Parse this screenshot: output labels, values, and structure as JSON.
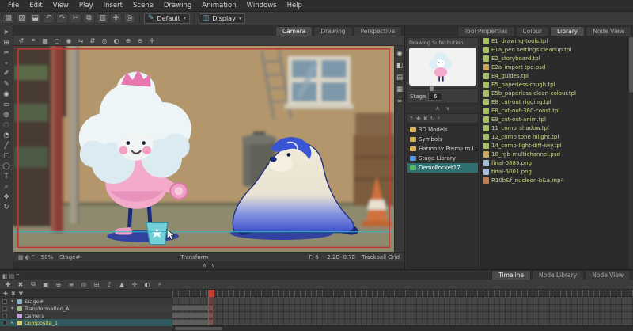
{
  "colors": {
    "accent_red": "#c63c32",
    "selection_teal": "#2f6f6f",
    "file_text_green": "#c9d48a",
    "layer_selected_yellow": "#e0d878",
    "camera_frame_red": "#bf3a34",
    "guide_cyan": "#35b8c4"
  },
  "menu_bar": {
    "items": [
      "File",
      "Edit",
      "View",
      "Play",
      "Insert",
      "Scene",
      "Drawing",
      "Animation",
      "Windows",
      "Help"
    ]
  },
  "top_toolbar": {
    "icons": [
      {
        "name": "new-scene-icon",
        "glyph": "▤"
      },
      {
        "name": "open-scene-icon",
        "glyph": "▧"
      },
      {
        "name": "save-icon",
        "glyph": "⬓"
      },
      {
        "name": "undo-icon",
        "glyph": "↶"
      },
      {
        "name": "redo-icon",
        "glyph": "↷"
      },
      {
        "name": "cut-icon",
        "glyph": "✂"
      },
      {
        "name": "copy-icon",
        "glyph": "⧉"
      },
      {
        "name": "paste-icon",
        "glyph": "▥"
      },
      {
        "name": "add-drawing-icon",
        "glyph": "✚"
      },
      {
        "name": "onion-skin-icon",
        "glyph": "◎"
      }
    ],
    "preset_dropdown_value": "Default",
    "brush_icon_glyph": "✎",
    "display_icon_glyph": "◫",
    "display_dropdown_value": "Display"
  },
  "tool_strip": {
    "icons": [
      {
        "name": "select-tool-icon",
        "glyph": "➤"
      },
      {
        "name": "transform-tool-icon",
        "glyph": "⊞"
      },
      {
        "name": "cutter-tool-icon",
        "glyph": "✂"
      },
      {
        "name": "contour-editor-icon",
        "glyph": "⌖"
      },
      {
        "name": "pencil-editor-icon",
        "glyph": "✐"
      },
      {
        "name": "brush-tool-icon",
        "glyph": "✎"
      },
      {
        "name": "stamp-tool-icon",
        "glyph": "◉"
      },
      {
        "name": "eraser-tool-icon",
        "glyph": "▭"
      },
      {
        "name": "paint-tool-icon",
        "glyph": "◍"
      },
      {
        "name": "ink-tool-icon",
        "glyph": "◌"
      },
      {
        "name": "dropper-tool-icon",
        "glyph": "◔"
      },
      {
        "name": "line-tool-icon",
        "glyph": "╱"
      },
      {
        "name": "rectangle-tool-icon",
        "glyph": "▢"
      },
      {
        "name": "ellipse-tool-icon",
        "glyph": "◯"
      },
      {
        "name": "text-tool-icon",
        "glyph": "T"
      },
      {
        "name": "zoom-tool-icon",
        "glyph": "⌕"
      },
      {
        "name": "hand-tool-icon",
        "glyph": "✥"
      },
      {
        "name": "rotate-view-icon",
        "glyph": "↻"
      }
    ]
  },
  "camera_panel": {
    "tabs": [
      {
        "label": "Camera",
        "active": true
      },
      {
        "label": "Drawing"
      },
      {
        "label": "Perspective"
      }
    ],
    "toolbar_icons": [
      {
        "name": "reset-view-icon",
        "glyph": "↺"
      },
      {
        "name": "grid-icon",
        "glyph": "⌗"
      },
      {
        "name": "safe-area-icon",
        "glyph": "▦"
      },
      {
        "name": "outline-mode-icon",
        "glyph": "◻"
      },
      {
        "name": "render-mode-icon",
        "glyph": "◉"
      },
      {
        "name": "flip-horizontal-icon",
        "glyph": "⇋"
      },
      {
        "name": "flip-vertical-icon",
        "glyph": "⇵"
      },
      {
        "name": "onion-skin-icon",
        "glyph": "◎"
      },
      {
        "name": "light-table-icon",
        "glyph": "◐"
      },
      {
        "name": "zoom-in-icon",
        "glyph": "⊕"
      },
      {
        "name": "zoom-out-icon",
        "glyph": "⊖"
      },
      {
        "name": "snap-icon",
        "glyph": "✛"
      }
    ],
    "side_icons": [
      {
        "name": "render-preview-icon",
        "glyph": "◉"
      },
      {
        "name": "matte-view-icon",
        "glyph": "◧"
      },
      {
        "name": "depth-view-icon",
        "glyph": "▤"
      },
      {
        "name": "camera-mask-icon",
        "glyph": "▦"
      },
      {
        "name": "guides-icon",
        "glyph": "⌗"
      }
    ],
    "status": {
      "left_icons": [
        {
          "name": "status-grid-icon",
          "glyph": "▦"
        },
        {
          "name": "status-light-icon",
          "glyph": "◐"
        },
        {
          "name": "status-snap-icon",
          "glyph": "⌗"
        }
      ],
      "zoom": "50%",
      "stage": "Stage#",
      "tool": "Transform",
      "frame": "F: 6",
      "camera_pos": "-2.2E -0.7E",
      "grid": "Trackball Grid"
    },
    "scrub_icons": [
      {
        "name": "previous-drawing-icon",
        "glyph": "∧"
      },
      {
        "name": "next-drawing-icon",
        "glyph": "∨"
      }
    ]
  },
  "right_panel": {
    "tabs": [
      {
        "label": "Tool Properties"
      },
      {
        "label": "Colour"
      },
      {
        "label": "Library",
        "active": true
      },
      {
        "label": "Node View"
      }
    ],
    "drawing_substitution": {
      "title": "Drawing Substitution",
      "stage_label": "Stage",
      "stage_value": "6"
    },
    "substitution_arrows": [
      {
        "name": "previous-substitution-icon",
        "glyph": "∧"
      },
      {
        "name": "next-substitution-icon",
        "glyph": "∨"
      }
    ],
    "library_toolbar_icons": [
      {
        "name": "folder-up-icon",
        "glyph": "↥"
      },
      {
        "name": "new-folder-icon",
        "glyph": "✚"
      },
      {
        "name": "delete-icon",
        "glyph": "✖"
      },
      {
        "name": "refresh-icon",
        "glyph": "↻"
      },
      {
        "name": "search-icon",
        "glyph": "⌕"
      }
    ],
    "folders": [
      {
        "label": "3D Models",
        "color": "#d8b25a"
      },
      {
        "label": "Symbols",
        "color": "#d8b25a"
      },
      {
        "label": "Harmony Premium Li",
        "color": "#d8b25a"
      },
      {
        "label": "Stage Library",
        "color": "#5a9ad8"
      },
      {
        "label": "DemoPocket17",
        "color": "#58b868",
        "selected": true
      }
    ],
    "files": [
      {
        "label": "E1_drawing-tools.tpl",
        "color": "#a6c05e"
      },
      {
        "label": "E1a_pen settings cleanup.tpl",
        "color": "#a6c05e"
      },
      {
        "label": "E2_storyboard.tpl",
        "color": "#a6c05e"
      },
      {
        "label": "E2a_import tpg.psd",
        "color": "#c9a858"
      },
      {
        "label": "E4_guides.tpl",
        "color": "#a6c05e"
      },
      {
        "label": "E5_paperless-rough.tpl",
        "color": "#a6c05e"
      },
      {
        "label": "E5b_paperless-clean-colour.tpl",
        "color": "#a6c05e"
      },
      {
        "label": "E8_cut-out rigging.tpl",
        "color": "#a6c05e"
      },
      {
        "label": "E8_cut-out-360-const.tpl",
        "color": "#a6c05e"
      },
      {
        "label": "E9_cut-out-anim.tpl",
        "color": "#a6c05e"
      },
      {
        "label": "11_comp_shadow.tpl",
        "color": "#a6c05e"
      },
      {
        "label": "12_comp tone hilight.tpl",
        "color": "#a6c05e"
      },
      {
        "label": "14_comp-light-diff-key.tpl",
        "color": "#a6c05e"
      },
      {
        "label": "18_rgb-multichannel.psd",
        "color": "#c9a858"
      },
      {
        "label": "final-0889.png",
        "color": "#9fc0d8"
      },
      {
        "label": "final-5001.png",
        "color": "#9fc0d8"
      },
      {
        "label": "R10b&f_nucleon-b&a.mp4",
        "color": "#c47a4e"
      }
    ]
  },
  "timeline": {
    "tabs": [
      {
        "label": "Timeline",
        "active": true
      },
      {
        "label": "Node Library"
      },
      {
        "label": "Node View"
      }
    ],
    "corner_icons": [
      {
        "name": "timeline-menu-icon",
        "glyph": "◧"
      },
      {
        "name": "timeline-list-icon",
        "glyph": "▤"
      },
      {
        "name": "timeline-grid-icon",
        "glyph": "⌗"
      }
    ],
    "toolbar_icons": [
      {
        "name": "add-layer-icon",
        "glyph": "✚"
      },
      {
        "name": "delete-layer-icon",
        "glyph": "✖"
      },
      {
        "name": "duplicate-layer-icon",
        "glyph": "⧉"
      },
      {
        "name": "clone-layer-icon",
        "glyph": "▣"
      },
      {
        "name": "add-peg-icon",
        "glyph": "⊕"
      },
      {
        "name": "collapse-icon",
        "glyph": "≡"
      },
      {
        "name": "onion-skin-icon",
        "glyph": "◎"
      },
      {
        "name": "transform-icon",
        "glyph": "⊞"
      },
      {
        "name": "sound-icon",
        "glyph": "♪"
      },
      {
        "name": "marker-icon",
        "glyph": "▲"
      },
      {
        "name": "snap-icon",
        "glyph": "✛"
      },
      {
        "name": "view-mode-icon",
        "glyph": "◐"
      },
      {
        "name": "zoom-timeline-icon",
        "glyph": "⌕"
      }
    ],
    "header_icons": [
      {
        "name": "layers-add-icon",
        "glyph": "✚"
      },
      {
        "name": "layers-delete-icon",
        "glyph": "✖"
      },
      {
        "name": "layers-filter-icon",
        "glyph": "▼"
      }
    ],
    "layers": [
      {
        "label": "Stage#",
        "arrow": "▾",
        "color": "#8fb4c8"
      },
      {
        "label": "Transformation_A",
        "arrow": "▾",
        "color": "#a0c08a",
        "exposure": true
      },
      {
        "label": "Camera",
        "arrow": "",
        "color": "#c0a0d8",
        "exposure": true
      },
      {
        "label": "Composite_1",
        "arrow": "▸",
        "color": "#d8c878",
        "exposure": true,
        "selected": true,
        "text_color": "#e0d878"
      }
    ]
  }
}
